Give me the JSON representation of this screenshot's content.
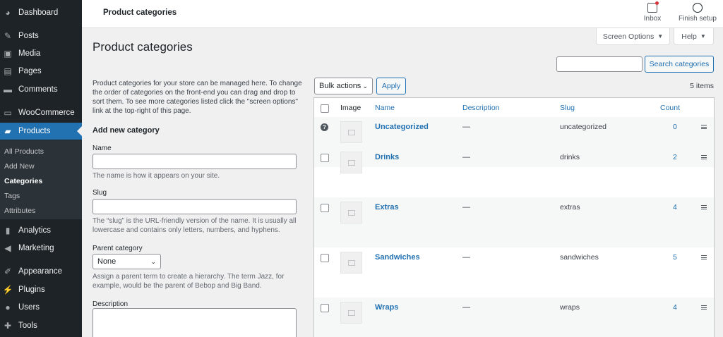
{
  "sidebar": {
    "items": [
      {
        "label": "Dashboard",
        "icon": "dashboard-icon"
      },
      {
        "label": "Posts",
        "icon": "pin-icon"
      },
      {
        "label": "Media",
        "icon": "media-icon"
      },
      {
        "label": "Pages",
        "icon": "pages-icon"
      },
      {
        "label": "Comments",
        "icon": "comments-icon"
      },
      {
        "label": "WooCommerce",
        "icon": "woocommerce-icon"
      },
      {
        "label": "Products",
        "icon": "products-icon"
      },
      {
        "label": "Analytics",
        "icon": "analytics-icon"
      },
      {
        "label": "Marketing",
        "icon": "megaphone-icon"
      },
      {
        "label": "Appearance",
        "icon": "brush-icon"
      },
      {
        "label": "Plugins",
        "icon": "plugin-icon"
      },
      {
        "label": "Users",
        "icon": "users-icon"
      },
      {
        "label": "Tools",
        "icon": "wrench-icon"
      }
    ],
    "submenu": [
      "All Products",
      "Add New",
      "Categories",
      "Tags",
      "Attributes"
    ]
  },
  "topbar": {
    "title": "Product categories",
    "inbox_label": "Inbox",
    "finish_setup_label": "Finish setup"
  },
  "screen_options_label": "Screen Options",
  "help_label": "Help",
  "page_title": "Product categories",
  "form": {
    "intro": "Product categories for your store can be managed here. To change the order of categories on the front-end you can drag and drop to sort them. To see more categories listed click the \"screen options\" link at the top-right of this page.",
    "heading": "Add new category",
    "name_label": "Name",
    "name_help": "The name is how it appears on your site.",
    "slug_label": "Slug",
    "slug_help": "The “slug” is the URL-friendly version of the name. It is usually all lowercase and contains only letters, numbers, and hyphens.",
    "parent_label": "Parent category",
    "parent_value": "None",
    "parent_help": "Assign a parent term to create a hierarchy. The term Jazz, for example, would be the parent of Bebop and Big Band.",
    "description_label": "Description"
  },
  "search_button": "Search categories",
  "bulk_actions_label": "Bulk actions",
  "apply_label": "Apply",
  "items_count": "5 items",
  "table": {
    "headers": {
      "image": "Image",
      "name": "Name",
      "description": "Description",
      "slug": "Slug",
      "count": "Count"
    },
    "rows": [
      {
        "name": "Uncategorized",
        "description": "—",
        "slug": "uncategorized",
        "count": "0"
      },
      {
        "name": "Drinks",
        "description": "—",
        "slug": "drinks",
        "count": "2"
      },
      {
        "name": "Extras",
        "description": "—",
        "slug": "extras",
        "count": "4"
      },
      {
        "name": "Sandwiches",
        "description": "—",
        "slug": "sandwiches",
        "count": "5"
      },
      {
        "name": "Wraps",
        "description": "—",
        "slug": "wraps",
        "count": "4"
      }
    ]
  }
}
